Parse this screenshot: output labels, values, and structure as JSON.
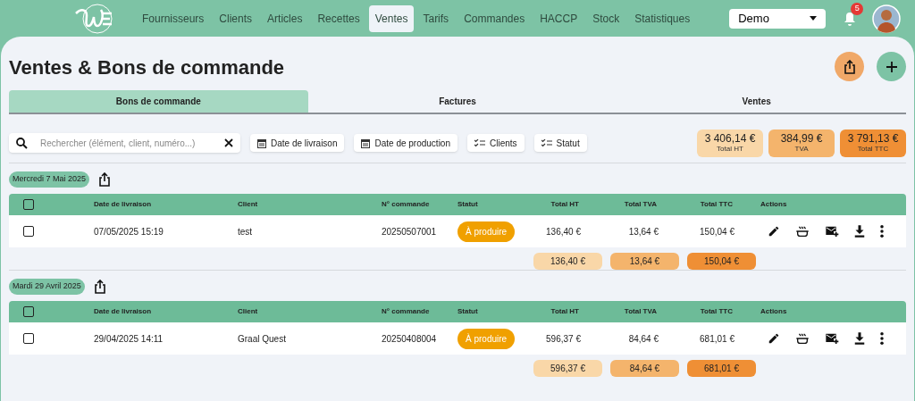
{
  "nav": {
    "items": [
      {
        "label": "Fournisseurs",
        "selected": false
      },
      {
        "label": "Clients",
        "selected": false
      },
      {
        "label": "Articles",
        "selected": false
      },
      {
        "label": "Recettes",
        "selected": false
      },
      {
        "label": "Ventes",
        "selected": true
      },
      {
        "label": "Tarifs",
        "selected": false
      },
      {
        "label": "Commandes",
        "selected": false
      },
      {
        "label": "HACCP",
        "selected": false
      },
      {
        "label": "Stock",
        "selected": false
      },
      {
        "label": "Statistiques",
        "selected": false
      }
    ],
    "company_select": "Demo",
    "notifications": "5"
  },
  "title": "Ventes & Bons de commande",
  "tabs": [
    {
      "label": "Bons de commande",
      "selected": true
    },
    {
      "label": "Factures",
      "selected": false
    },
    {
      "label": "Ventes",
      "selected": false
    }
  ],
  "search": {
    "placeholder": "Rechercher (élément, client, numéro...)"
  },
  "filters": [
    {
      "label": "Date de livraison",
      "kind": "date"
    },
    {
      "label": "Date de production",
      "kind": "date"
    },
    {
      "label": "Clients",
      "kind": "list"
    },
    {
      "label": "Statut",
      "kind": "list"
    }
  ],
  "summary": [
    {
      "value": "3 406,14 €",
      "label": "Total HT",
      "color": "#f9d7a8"
    },
    {
      "value": "384,99 €",
      "label": "TVA",
      "color": "#f4b46c"
    },
    {
      "value": "3 791,13 €",
      "label": "Total TTC",
      "color": "#ef8f35"
    }
  ],
  "groups": [
    {
      "date": "Mercredi 7 Mai 2025",
      "select_all": false,
      "columns": [
        "Date de livraison",
        "Client",
        "N° commande",
        "Statut",
        "Total HT",
        "Total TVA",
        "Total TTC",
        "Actions"
      ],
      "rows": [
        {
          "checked": false,
          "date": "07/05/2025 15:19",
          "client": "test",
          "number": "20250507001",
          "status": "À produire",
          "ht": "136,40 €",
          "tva": "13,64 €",
          "ttc": "150,04 €"
        }
      ],
      "totals": [
        "136,40 €",
        "13,64 €",
        "150,04 €"
      ]
    },
    {
      "date": "Mardi 29 Avril 2025",
      "select_all": false,
      "columns": [
        "Date de livraison",
        "Client",
        "N° commande",
        "Statut",
        "Total HT",
        "Total TVA",
        "Total TTC",
        "Actions"
      ],
      "rows": [
        {
          "checked": false,
          "date": "29/04/2025 14:11",
          "client": "Graal Quest",
          "number": "20250408004",
          "status": "À produire",
          "ht": "596,37 €",
          "tva": "84,64 €",
          "ttc": "681,01 €"
        }
      ],
      "totals": [
        "596,37 €",
        "84,64 €",
        "681,01 €"
      ]
    }
  ]
}
